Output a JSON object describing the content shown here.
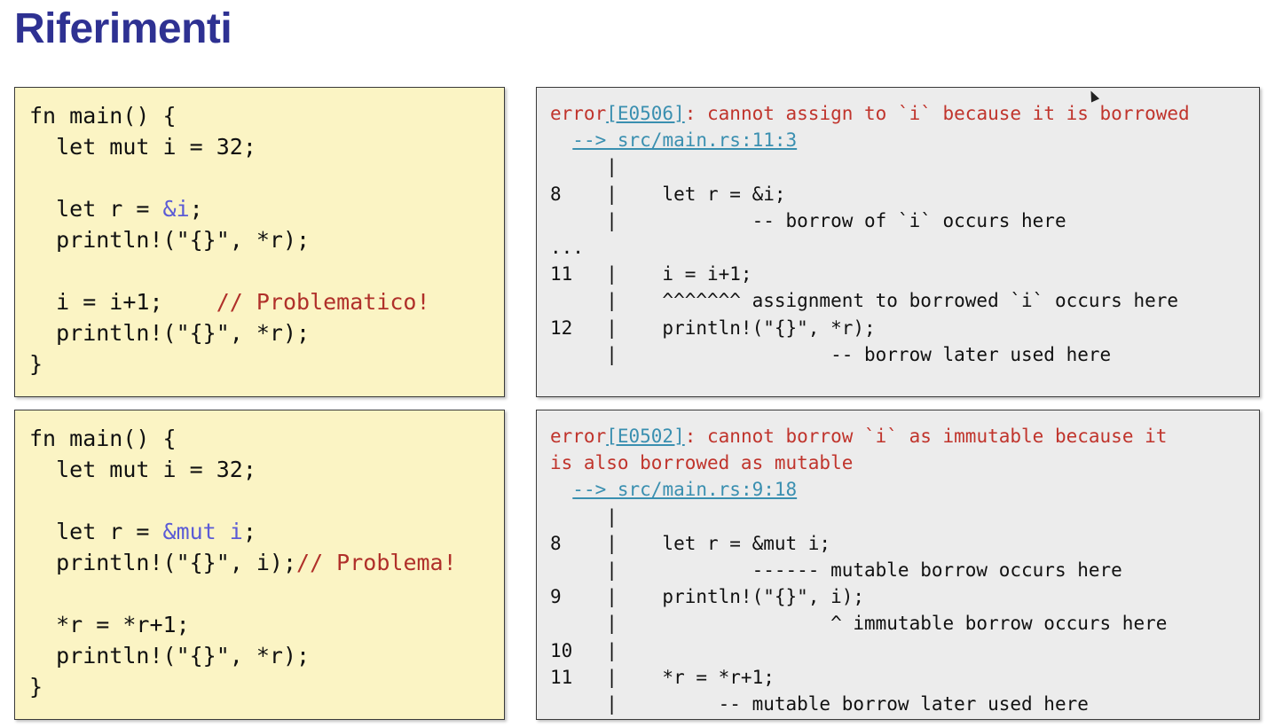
{
  "title": "Riferimenti",
  "example1": {
    "code": [
      "fn main() {",
      "  let mut i = 32;",
      "",
      "  let r = ",
      "  println!(\"{}\", *r);",
      "",
      "  i = i+1;    ",
      "  println!(\"{}\", *r);",
      "}"
    ],
    "ref_expr": "&i",
    "ref_suffix": ";",
    "comment": "// Problematico!",
    "error": {
      "prefix": "error",
      "code": "[E0506]",
      "message": ": cannot assign to `i` because it is borrowed",
      "location": "--> src/main.rs:11:3",
      "lines": [
        "     |",
        "8    |    let r = &i;",
        "     |            -- borrow of `i` occurs here",
        "...",
        "11   |    i = i+1;",
        "     |    ^^^^^^^ assignment to borrowed `i` occurs here",
        "12   |    println!(\"{}\", *r);",
        "     |                   -- borrow later used here"
      ]
    }
  },
  "example2": {
    "code": [
      "fn main() {",
      "  let mut i = 32;",
      "",
      "  let r = ",
      "  println!(\"{}\", i);",
      "",
      "  *r = *r+1;",
      "  println!(\"{}\", *r);",
      "}"
    ],
    "ref_expr": "&mut i",
    "ref_suffix": ";",
    "comment": "// Problema!",
    "error": {
      "prefix": "error",
      "code": "[E0502]",
      "message": ": cannot borrow `i` as immutable because it",
      "message2": "is also borrowed as mutable",
      "location": "--> src/main.rs:9:18",
      "lines": [
        "     |",
        "8    |    let r = &mut i;",
        "     |            ------ mutable borrow occurs here",
        "9    |    println!(\"{}\", i);",
        "     |                   ^ immutable borrow occurs here",
        "10   |",
        "11   |    *r = *r+1;",
        "     |         -- mutable borrow later used here"
      ]
    }
  }
}
